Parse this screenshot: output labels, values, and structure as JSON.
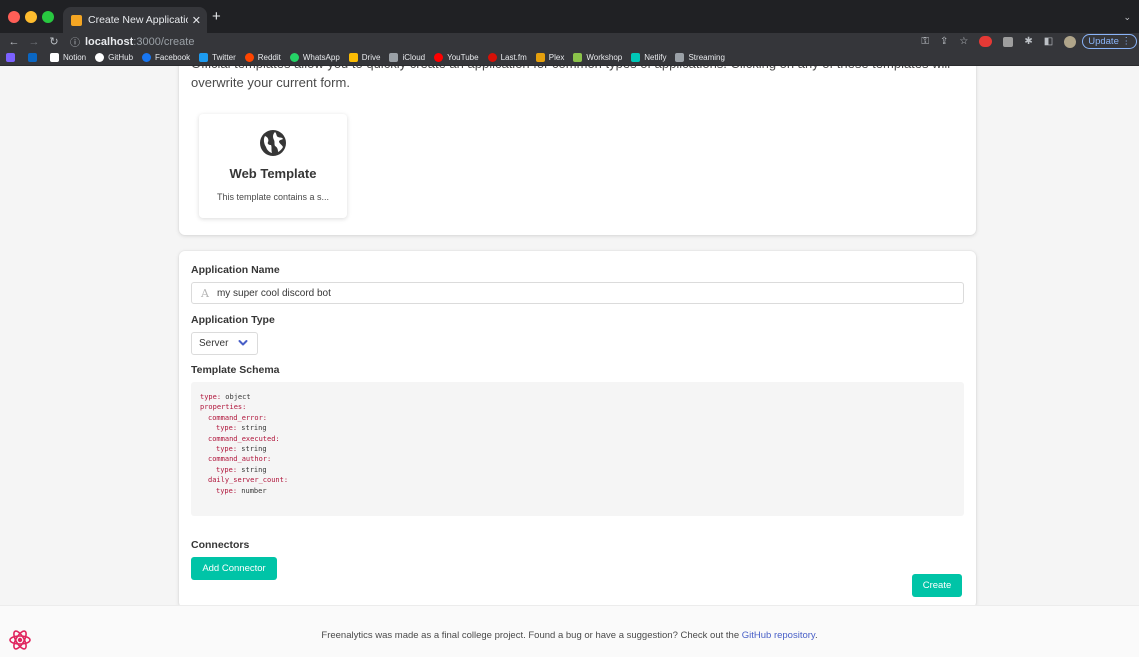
{
  "browser": {
    "tab_title": "Create New Application - Freenalytics",
    "url_host": "localhost",
    "url_path": ":3000/create",
    "update_label": "Update",
    "bookmarks": [
      {
        "label": "",
        "color": "#7b61ff",
        "icon": "app-icon"
      },
      {
        "label": "",
        "color": "#0a66c2",
        "icon": "linkedin-icon"
      },
      {
        "label": "Notion",
        "color": "#ffffff",
        "icon": "notion-icon"
      },
      {
        "label": "GitHub",
        "color": "#ffffff",
        "icon": "github-icon"
      },
      {
        "label": "Facebook",
        "color": "#1877f2",
        "icon": "facebook-icon"
      },
      {
        "label": "Twitter",
        "color": "#1d9bf0",
        "icon": "twitter-icon"
      },
      {
        "label": "Reddit",
        "color": "#ff4500",
        "icon": "reddit-icon"
      },
      {
        "label": "WhatsApp",
        "color": "#25d366",
        "icon": "whatsapp-icon"
      },
      {
        "label": "Drive",
        "color": "#fbbc04",
        "icon": "drive-icon"
      },
      {
        "label": "iCloud",
        "color": "#9aa0a6",
        "icon": "icloud-icon"
      },
      {
        "label": "YouTube",
        "color": "#ff0000",
        "icon": "youtube-icon"
      },
      {
        "label": "Last.fm",
        "color": "#d51007",
        "icon": "lastfm-icon"
      },
      {
        "label": "Plex",
        "color": "#e5a00d",
        "icon": "plex-icon"
      },
      {
        "label": "Workshop",
        "color": "#8bc34a",
        "icon": "workshop-icon"
      },
      {
        "label": "Netlify",
        "color": "#00c7b7",
        "icon": "netlify-icon"
      },
      {
        "label": "Streaming",
        "color": "#9aa0a6",
        "icon": "folder-icon"
      }
    ]
  },
  "templates": {
    "intro": "Official templates allow you to quickly create an application for common types of applications. Clicking on any of these templates will overwrite your current form.",
    "items": [
      {
        "title": "Web Template",
        "description": "This template contains a s...",
        "icon": "globe-icon"
      }
    ]
  },
  "form": {
    "name_label": "Application Name",
    "name_value": "my super cool discord bot",
    "type_label": "Application Type",
    "type_value": "Server",
    "schema_label": "Template Schema",
    "schema_lines": [
      {
        "key": "type:",
        "val": " object",
        "indent": 0
      },
      {
        "key": "properties:",
        "val": "",
        "indent": 0
      },
      {
        "key": "command_error:",
        "val": "",
        "indent": 1
      },
      {
        "key": "type:",
        "val": " string",
        "indent": 2
      },
      {
        "key": "command_executed:",
        "val": "",
        "indent": 1
      },
      {
        "key": "type:",
        "val": " string",
        "indent": 2
      },
      {
        "key": "command_author:",
        "val": "",
        "indent": 1
      },
      {
        "key": "type:",
        "val": " string",
        "indent": 2
      },
      {
        "key": "daily_server_count:",
        "val": "",
        "indent": 1
      },
      {
        "key": "type:",
        "val": " number",
        "indent": 2
      }
    ],
    "connectors_label": "Connectors",
    "add_connector_label": "Add Connector",
    "create_label": "Create"
  },
  "footer": {
    "text": "Freenalytics was made as a final college project. Found a bug or have a suggestion? Check out the ",
    "link": "GitHub repository",
    "suffix": "."
  },
  "colors": {
    "accent": "#00c4a7",
    "link": "#485fc7",
    "code_key": "#b0143a"
  }
}
